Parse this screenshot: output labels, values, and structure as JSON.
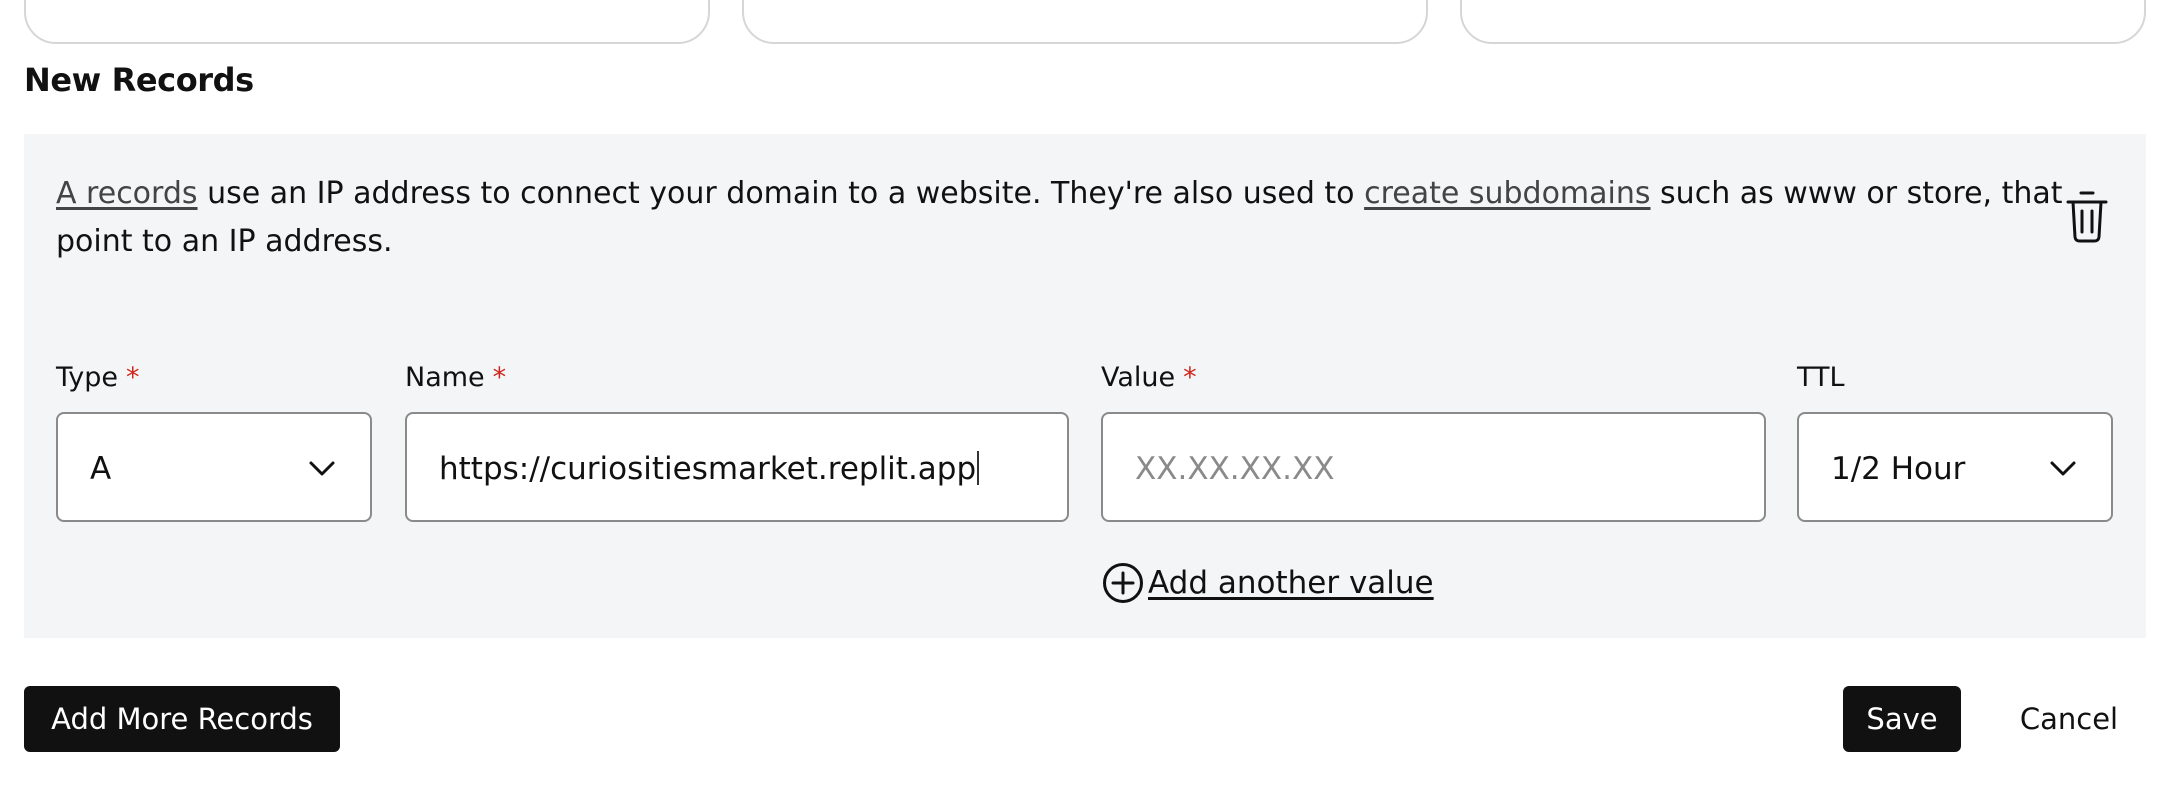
{
  "section": {
    "title": "New Records"
  },
  "description": {
    "link_a_records": "A records",
    "text_1": " use an IP address to connect your domain to a website. They're also used to ",
    "link_subdomains": "create subdomains",
    "text_2": " such as www or store, that point to an IP address."
  },
  "icons": {
    "delete": "trash-icon",
    "chevron": "chevron-down-icon",
    "add": "plus-circle-icon"
  },
  "fields": {
    "type": {
      "label": "Type",
      "required_mark": "*",
      "value": "A"
    },
    "name": {
      "label": "Name",
      "required_mark": "*",
      "value": "https://curiositiesmarket.replit.app"
    },
    "value": {
      "label": "Value",
      "required_mark": "*",
      "placeholder": "XX.XX.XX.XX"
    },
    "ttl": {
      "label": "TTL",
      "value": "1/2 Hour"
    }
  },
  "add_value": {
    "label": "Add another value"
  },
  "actions": {
    "add_more": "Add More Records",
    "save": "Save",
    "cancel": "Cancel"
  },
  "colors": {
    "panel_background": "#f4f5f7",
    "required_star": "#d0271d",
    "primary_button": "#111111",
    "input_border": "#8a8a8a"
  }
}
